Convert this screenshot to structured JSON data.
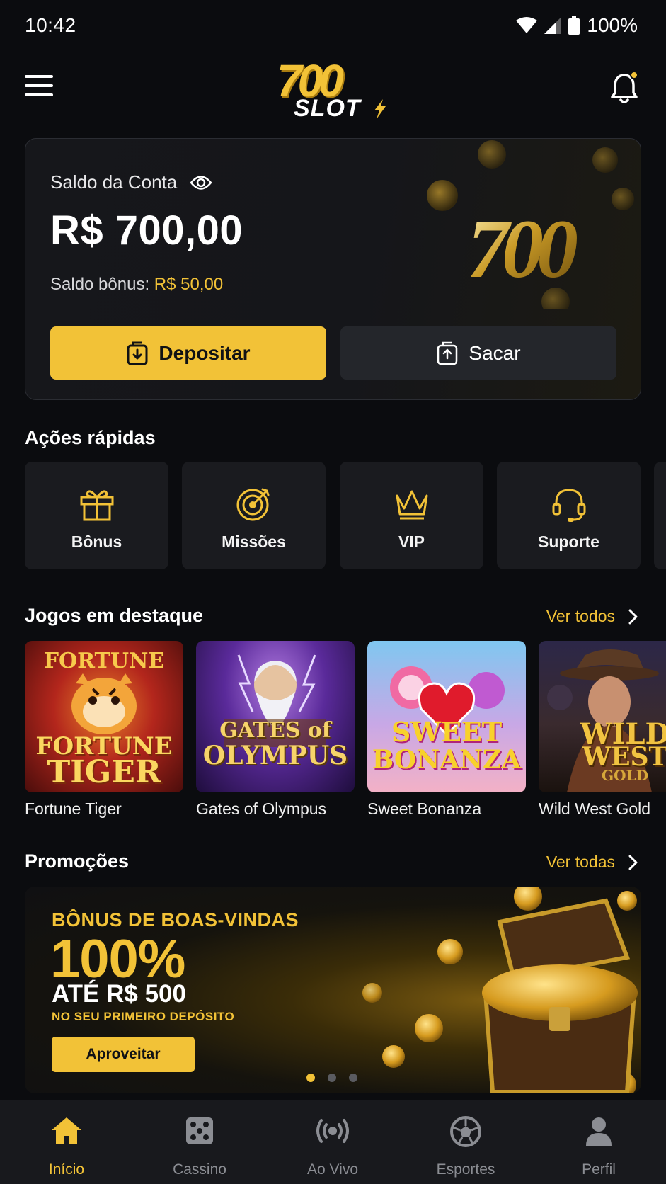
{
  "status_bar": {
    "time": "10:42",
    "battery": "100%"
  },
  "header": {
    "logo_number": "700",
    "logo_word": "SLOT"
  },
  "balance": {
    "label": "Saldo da Conta",
    "value": "R$ 700,00",
    "bonus_label": "Saldo bônus:",
    "bonus_value": "R$ 50,00",
    "card_art_text": "700",
    "deposit_label": "Depositar",
    "withdraw_label": "Sacar"
  },
  "quick_actions": {
    "title": "Ações rápidas",
    "items": [
      {
        "label": "Bônus",
        "icon": "gift-icon"
      },
      {
        "label": "Missões",
        "icon": "target-icon"
      },
      {
        "label": "VIP",
        "icon": "crown-icon"
      },
      {
        "label": "Suporte",
        "icon": "headset-icon"
      }
    ]
  },
  "featured_games": {
    "title": "Jogos em destaque",
    "see_all": "Ver todos",
    "games": [
      {
        "name": "Fortune Tiger",
        "art_line1": "FORTUNE",
        "art_line2": "FORTUNE",
        "art_line3": "TIGER"
      },
      {
        "name": "Gates of Olympus",
        "art_line1": "GATES of",
        "art_line2": "OLYMPUS"
      },
      {
        "name": "Sweet Bonanza",
        "art_line1": "SWEET",
        "art_line2": "BONANZA"
      },
      {
        "name": "Wild West Gold",
        "art_line1": "WILD",
        "art_line2": "WEST",
        "art_line3": "GOLD"
      }
    ]
  },
  "promotions": {
    "title": "Promoções",
    "see_all": "Ver todas",
    "banner": {
      "kicker": "BÔNUS DE BOAS-VINDAS",
      "percent": "100%",
      "amount": "ATÉ R$ 500",
      "note": "NO SEU PRIMEIRO DEPÓSITO",
      "button": "Aproveitar"
    },
    "slides_total": 3,
    "active_slide": 1
  },
  "bottom_nav": [
    {
      "label": "Início",
      "icon": "home-icon",
      "active": true
    },
    {
      "label": "Cassino",
      "icon": "dice-icon",
      "active": false
    },
    {
      "label": "Ao Vivo",
      "icon": "live-broadcast-icon",
      "active": false
    },
    {
      "label": "Esportes",
      "icon": "soccer-ball-icon",
      "active": false
    },
    {
      "label": "Perfil",
      "icon": "user-icon",
      "active": false
    }
  ],
  "colors": {
    "accent": "#f2c237",
    "background": "#0b0c0f",
    "card": "#1a1b1f",
    "nav_inactive": "#8b8d93"
  }
}
